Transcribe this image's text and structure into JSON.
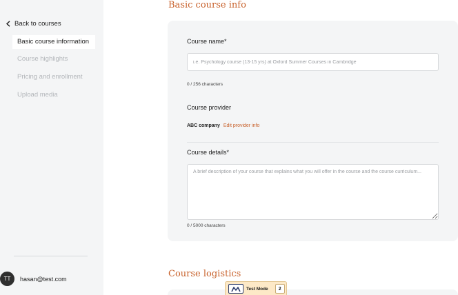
{
  "sidebar": {
    "back_label": "Back to courses",
    "items": [
      {
        "label": "Basic course information",
        "active": true
      },
      {
        "label": "Course highlights",
        "active": false
      },
      {
        "label": "Pricing and enrollment",
        "active": false
      },
      {
        "label": "Upload media",
        "active": false
      }
    ],
    "user": {
      "initials": "TT",
      "email": "hasan@test.com"
    }
  },
  "main": {
    "section_title": "Basic course info",
    "course_name": {
      "label": "Course name*",
      "value": "",
      "placeholder": "i.e. Psychology course (13-15 yrs) at Oxford Summer Courses in Cambridge",
      "counter": "0 / 256 characters"
    },
    "provider": {
      "label": "Course provider",
      "name": "ABC company",
      "edit_link": "Edit provider info"
    },
    "course_details": {
      "label": "Course details*",
      "value": "",
      "placeholder": "A brief description of your course that explains what you will offer in the course and the course curriculum...",
      "counter": "0 / 5000 characters"
    },
    "section2_title": "Course logistics"
  },
  "test_mode": {
    "label": "Test Mode",
    "count": "2"
  },
  "colors": {
    "accent": "#c8612b",
    "sidebar_bg": "#f4f5f6",
    "card_bg": "#f4f5f6"
  }
}
